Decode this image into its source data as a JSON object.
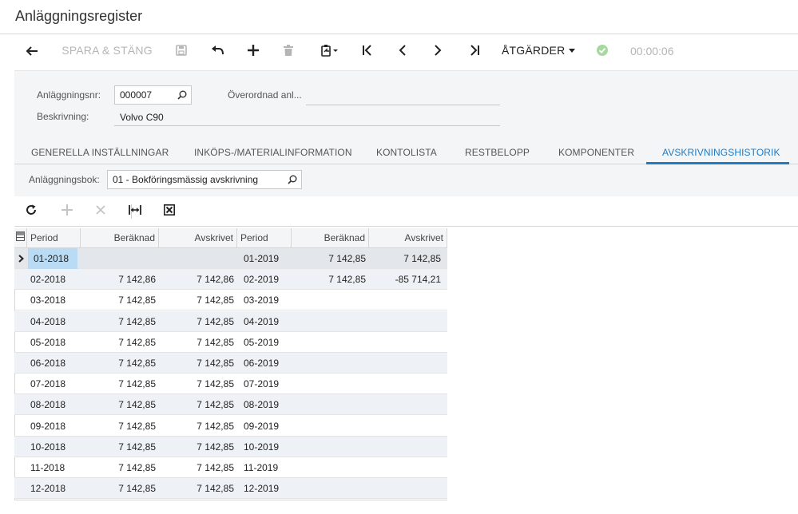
{
  "app": {
    "title": "Anläggningsregister"
  },
  "toolbar": {
    "save_close_label": "SPARA & STÄNG",
    "actions_label": "ÅTGÄRDER",
    "timer": "00:00:06",
    "status_color": "#a6d8a0"
  },
  "form": {
    "asset_no_label": "Anläggningsnr:",
    "asset_no_value": "000007",
    "parent_label": "Överordnad anl...",
    "parent_value": "",
    "description_label": "Beskrivning:",
    "description_value": "Volvo C90"
  },
  "tabs": [
    {
      "label": "GENERELLA INSTÄLLNINGAR"
    },
    {
      "label": "INKÖPS-/MATERIALINFORMATION"
    },
    {
      "label": "KONTOLISTA"
    },
    {
      "label": "RESTBELOPP"
    },
    {
      "label": "KOMPONENTER"
    },
    {
      "label": "AVSKRIVNINGSHISTORIK"
    }
  ],
  "active_tab": "AVSKRIVNINGSHISTORIK",
  "accent_color": "#1e7bc6",
  "book": {
    "label": "Anläggningsbok:",
    "value": "01 - Bokföringsmässig avskrivning"
  },
  "grid": {
    "columns": [
      "Period",
      "Beräknad",
      "Avskrivet",
      "Period",
      "Beräknad",
      "Avskrivet"
    ],
    "rows": [
      [
        "01-2018",
        "",
        "",
        "01-2019",
        "7 142,85",
        "7 142,85"
      ],
      [
        "02-2018",
        "7 142,86",
        "7 142,86",
        "02-2019",
        "7 142,85",
        "-85 714,21"
      ],
      [
        "03-2018",
        "7 142,85",
        "7 142,85",
        "03-2019",
        "",
        ""
      ],
      [
        "04-2018",
        "7 142,85",
        "7 142,85",
        "04-2019",
        "",
        ""
      ],
      [
        "05-2018",
        "7 142,85",
        "7 142,85",
        "05-2019",
        "",
        ""
      ],
      [
        "06-2018",
        "7 142,85",
        "7 142,85",
        "06-2019",
        "",
        ""
      ],
      [
        "07-2018",
        "7 142,85",
        "7 142,85",
        "07-2019",
        "",
        ""
      ],
      [
        "08-2018",
        "7 142,85",
        "7 142,85",
        "08-2019",
        "",
        ""
      ],
      [
        "09-2018",
        "7 142,85",
        "7 142,85",
        "09-2019",
        "",
        ""
      ],
      [
        "10-2018",
        "7 142,85",
        "7 142,85",
        "10-2019",
        "",
        ""
      ],
      [
        "11-2018",
        "7 142,85",
        "7 142,85",
        "11-2019",
        "",
        ""
      ],
      [
        "12-2018",
        "7 142,85",
        "7 142,85",
        "12-2019",
        "",
        ""
      ]
    ]
  }
}
